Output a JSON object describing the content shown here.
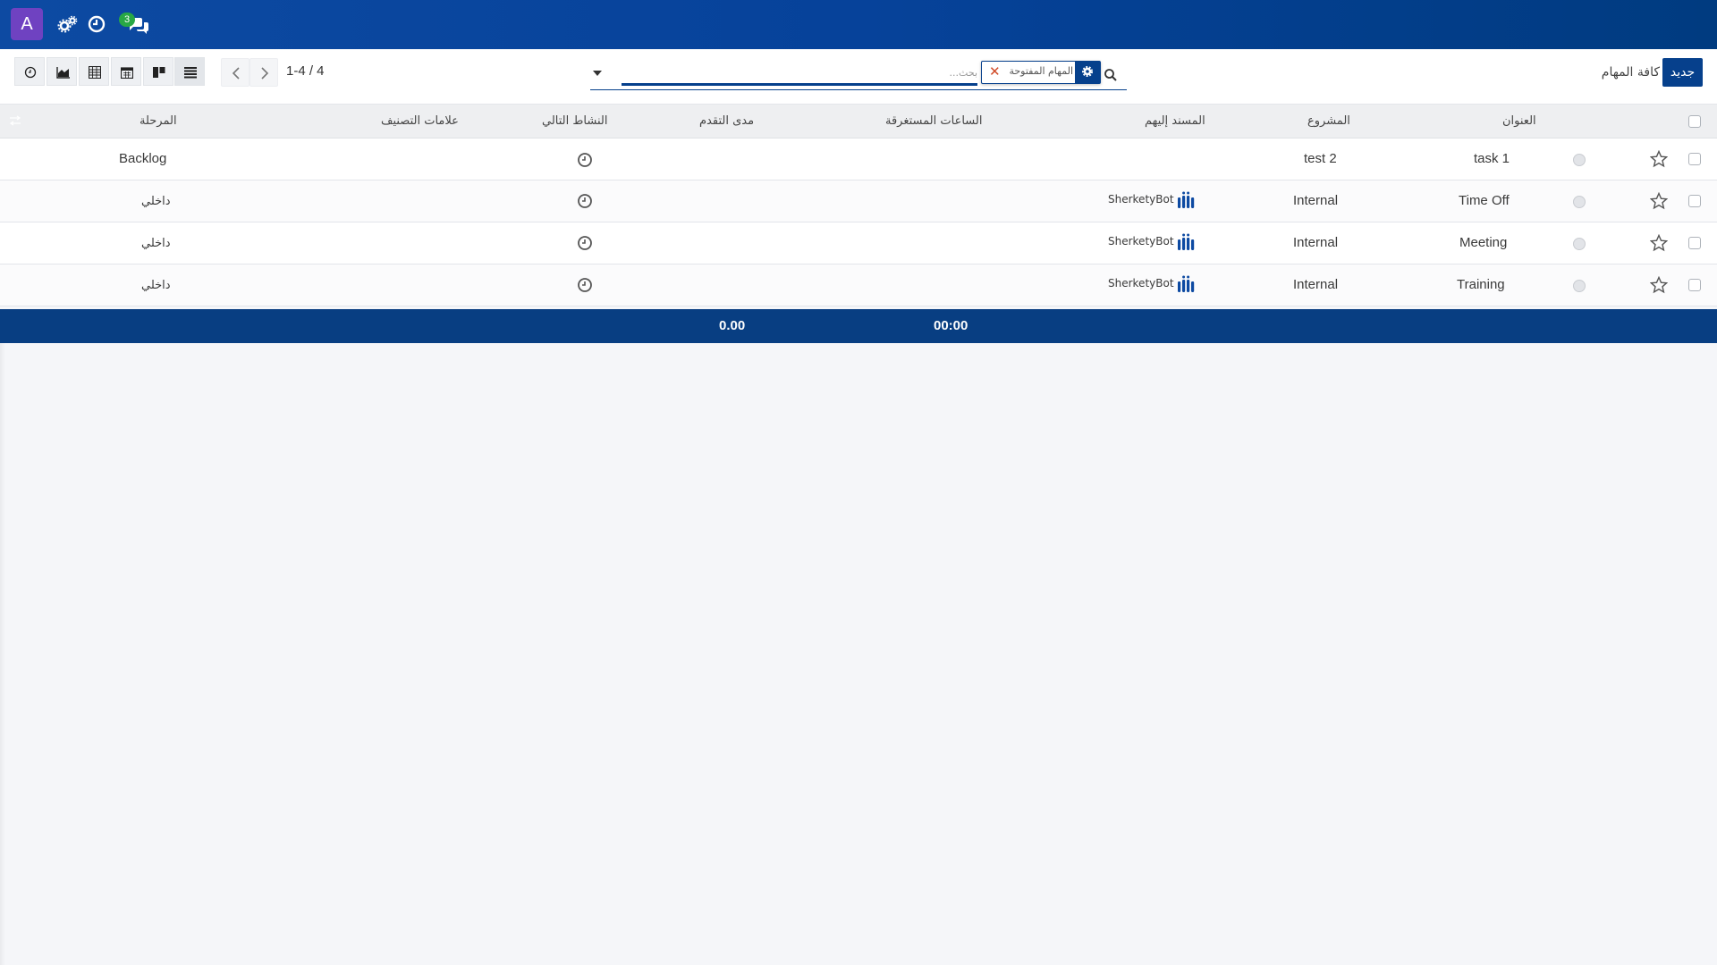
{
  "navbar": {
    "avatar_letter": "A",
    "icons": [
      "settings-gears-icon",
      "clock-icon",
      "chat-icon"
    ],
    "chat_badge": "3"
  },
  "control": {
    "new_button": "جديد",
    "breadcrumb": "كافة المهام",
    "search": {
      "facet_label": "المهام المفتوحة",
      "placeholder": "بحث..."
    },
    "pager": "1-4 / 4",
    "views": [
      "list-view",
      "kanban-view",
      "calendar-view",
      "pivot-view",
      "graph-view",
      "activity-view"
    ]
  },
  "colors": {
    "brand": "#06408c",
    "avatar": "#6f42c1",
    "badge": "#28a745",
    "facet_remove": "#d04a27"
  },
  "table": {
    "headers": {
      "title": "العنوان",
      "project": "المشروع",
      "assignee": "المسند إليهم",
      "hours": "الساعات المستغرقة",
      "progress": "مدى التقدم",
      "next_activity": "النشاط التالي",
      "tags": "علامات التصنيف",
      "stage": "المرحلة"
    },
    "rows": [
      {
        "title": "task 1",
        "project": "test 2",
        "assignee": "",
        "stage": "Backlog"
      },
      {
        "title": "Time Off",
        "project": "Internal",
        "assignee": "SherketyBot",
        "stage": "داخلي"
      },
      {
        "title": "Meeting",
        "project": "Internal",
        "assignee": "SherketyBot",
        "stage": "داخلي"
      },
      {
        "title": "Training",
        "project": "Internal",
        "assignee": "SherketyBot",
        "stage": "داخلي"
      }
    ],
    "totals": {
      "hours": "00:00",
      "progress": "0.00"
    }
  }
}
